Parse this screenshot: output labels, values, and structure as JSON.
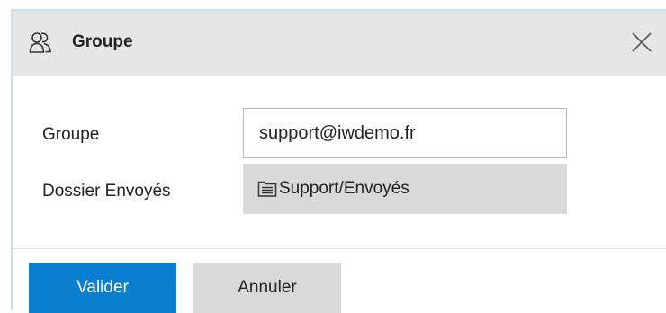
{
  "dialog": {
    "title": "Groupe",
    "header_icon": "group-users-icon",
    "close_icon": "close-icon"
  },
  "form": {
    "group_label": "Groupe",
    "group_value": "support@iwdemo.fr",
    "sent_folder_label": "Dossier Envoyés",
    "sent_folder_icon": "folder-list-icon",
    "sent_folder_value": "Support/Envoyés"
  },
  "footer": {
    "validate_label": "Valider",
    "cancel_label": "Annuler"
  },
  "colors": {
    "primary": "#0a7fd0",
    "header_bg": "#e6e6e6",
    "secondary_button": "#d9d9d9"
  }
}
